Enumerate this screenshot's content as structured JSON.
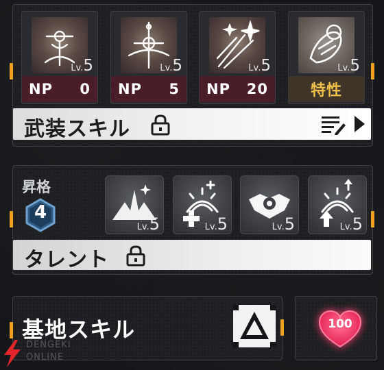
{
  "weapon": {
    "cards": [
      {
        "lv_prefix": "Lv.",
        "lv": "5",
        "np_label": "NP",
        "np_value": "0",
        "icon": "sword-emblem-icon"
      },
      {
        "lv_prefix": "Lv.",
        "lv": "5",
        "np_label": "NP",
        "np_value": "5",
        "icon": "crossed-blade-icon"
      },
      {
        "lv_prefix": "Lv.",
        "lv": "5",
        "np_label": "NP",
        "np_value": "20",
        "icon": "star-burst-icon"
      }
    ],
    "trait_card": {
      "lv_prefix": "Lv.",
      "lv": "5",
      "label": "特性",
      "icon": "clasped-hands-icon"
    },
    "skill_bar_label": "武装スキル"
  },
  "ascension": {
    "label": "昇格",
    "level": "4",
    "talents": [
      {
        "lv_prefix": "Lv.",
        "lv": "5",
        "icon": "mountain-spire-icon"
      },
      {
        "lv_prefix": "Lv.",
        "lv": "5",
        "icon": "radiant-plus-icon"
      },
      {
        "lv_prefix": "Lv.",
        "lv": "5",
        "icon": "shield-gear-icon"
      },
      {
        "lv_prefix": "Lv.",
        "lv": "5",
        "icon": "radiant-up-icon"
      }
    ],
    "talent_bar_label": "タレント"
  },
  "base": {
    "label": "基地スキル",
    "affection": "100"
  },
  "watermark": {
    "line1": "DENGEKI",
    "line2": "ONLINE"
  },
  "colors": {
    "accent": "#f4a11f",
    "np_bg": "#4a1e28",
    "trait_text": "#f0c04a",
    "heart": "#ff3d6e"
  }
}
